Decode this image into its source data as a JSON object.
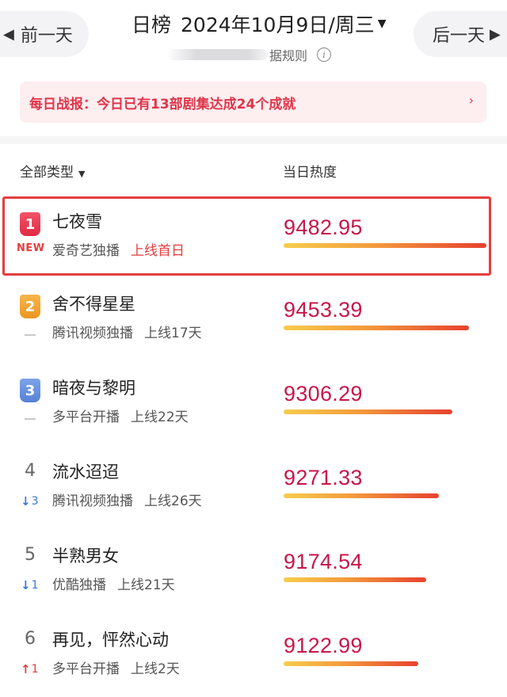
{
  "header": {
    "prev_label": "前一天",
    "next_label": "后一天",
    "title": "日榜",
    "date": "2024年10月9日/周三",
    "rule_text": "据规则"
  },
  "banner": {
    "text": "每日战报：今日已有13部剧集达成24个成就"
  },
  "columns": {
    "type_label": "全部类型",
    "heat_label": "当日热度"
  },
  "rows": [
    {
      "rank": "1",
      "name": "七夜雪",
      "platform": "爱奇艺独播",
      "online": "上线首日",
      "heat": "9482.95",
      "badge": "NEW",
      "trend_value": "",
      "heat_fraction": 1.0
    },
    {
      "rank": "2",
      "name": "舍不得星星",
      "platform": "腾讯视频独播",
      "online": "上线17天",
      "heat": "9453.39",
      "badge": "",
      "trend_value": "",
      "heat_fraction": 0.91
    },
    {
      "rank": "3",
      "name": "暗夜与黎明",
      "platform": "多平台开播",
      "online": "上线22天",
      "heat": "9306.29",
      "badge": "",
      "trend_value": "",
      "heat_fraction": 0.83
    },
    {
      "rank": "4",
      "name": "流水迢迢",
      "platform": "腾讯视频独播",
      "online": "上线26天",
      "heat": "9271.33",
      "badge": "",
      "trend_value": "3",
      "heat_fraction": 0.77
    },
    {
      "rank": "5",
      "name": "半熟男女",
      "platform": "优酷独播",
      "online": "上线21天",
      "heat": "9174.54",
      "badge": "",
      "trend_value": "1",
      "heat_fraction": 0.7
    },
    {
      "rank": "6",
      "name": "再见，怦然心动",
      "platform": "多平台开播",
      "online": "上线2天",
      "heat": "9122.99",
      "badge": "",
      "trend_value": "1",
      "heat_fraction": 0.66
    }
  ],
  "colors": {
    "accent_red": "#e43d3d",
    "heat_text": "#c8174a",
    "trend_down": "#3c78d8",
    "trend_up": "#e43d3d"
  },
  "icons": {
    "prev": "chevron-left-icon",
    "next": "chevron-right-icon",
    "date_dropdown": "caret-down-icon",
    "info": "info-icon",
    "banner": "chevron-right-icon",
    "type_filter": "caret-down-icon",
    "trend_down": "arrow-down-icon",
    "trend_up": "arrow-up-icon"
  }
}
